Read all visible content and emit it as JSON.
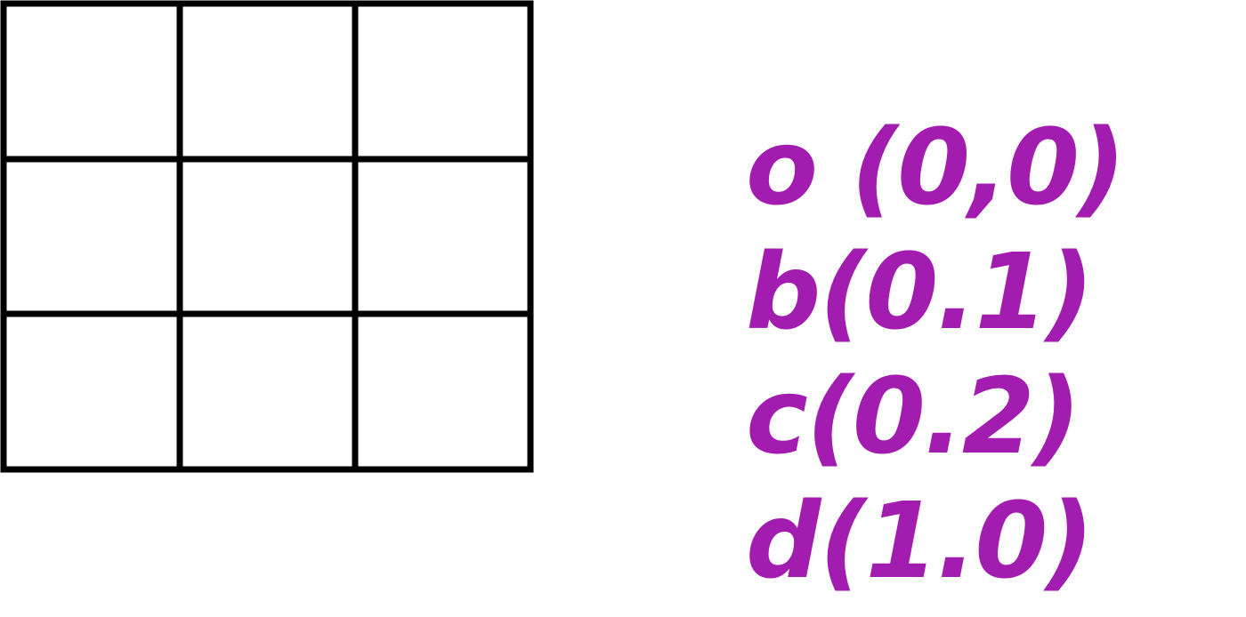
{
  "grid": {
    "rows": 3,
    "cols": 3,
    "line_color": "#000000",
    "fill_color": "#ffffff"
  },
  "labels": {
    "color": "#a21caf",
    "items": [
      {
        "text": "o (0,0)"
      },
      {
        "text": "b(0.1)"
      },
      {
        "text": "c(0.2)"
      },
      {
        "text": "d(1.0)"
      }
    ]
  }
}
